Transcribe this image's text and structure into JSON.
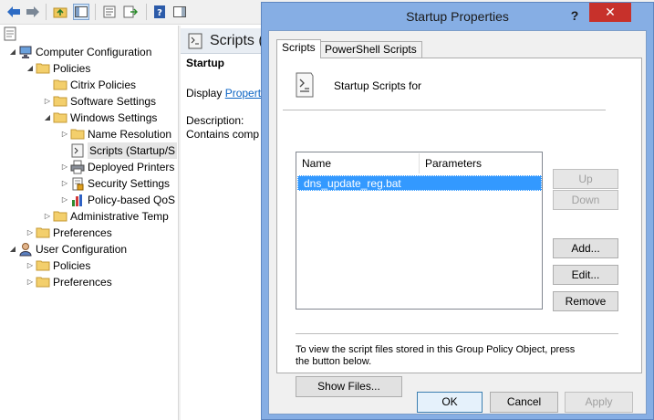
{
  "tree": {
    "root_icon": "document-icon",
    "items": [
      {
        "label": "Computer Configuration",
        "depth": 0,
        "expander": "expanded",
        "icon": "computer-icon"
      },
      {
        "label": "Policies",
        "depth": 1,
        "expander": "expanded",
        "icon": "folder-icon"
      },
      {
        "label": "Citrix Policies",
        "depth": 2,
        "expander": "none",
        "icon": "folder-icon"
      },
      {
        "label": "Software Settings",
        "depth": 2,
        "expander": "collapsed",
        "icon": "folder-icon"
      },
      {
        "label": "Windows Settings",
        "depth": 2,
        "expander": "expanded",
        "icon": "folder-icon"
      },
      {
        "label": "Name Resolution",
        "depth": 3,
        "expander": "collapsed",
        "icon": "folder-icon"
      },
      {
        "label": "Scripts (Startup/S",
        "depth": 3,
        "expander": "none",
        "icon": "script-icon",
        "selected": true
      },
      {
        "label": "Deployed Printers",
        "depth": 3,
        "expander": "collapsed",
        "icon": "printer-icon"
      },
      {
        "label": "Security Settings",
        "depth": 3,
        "expander": "collapsed",
        "icon": "security-icon"
      },
      {
        "label": "Policy-based QoS",
        "depth": 3,
        "expander": "collapsed",
        "icon": "chart-icon"
      },
      {
        "label": "Administrative Temp",
        "depth": 2,
        "expander": "collapsed",
        "icon": "folder-icon"
      },
      {
        "label": "Preferences",
        "depth": 1,
        "expander": "collapsed",
        "icon": "folder-icon"
      },
      {
        "label": "User Configuration",
        "depth": 0,
        "expander": "expanded",
        "icon": "user-icon"
      },
      {
        "label": "Policies",
        "depth": 1,
        "expander": "collapsed",
        "icon": "folder-icon"
      },
      {
        "label": "Preferences",
        "depth": 1,
        "expander": "collapsed",
        "icon": "folder-icon"
      }
    ]
  },
  "right_pane": {
    "title": "Scripts (",
    "section": "Startup",
    "display_prefix": "Display",
    "display_link": "Propert",
    "description_label": "Description:",
    "description_text": "Contains comp"
  },
  "dialog": {
    "title": "Startup Properties",
    "help_glyph": "?",
    "close_glyph": "✕",
    "tabs": [
      "Scripts",
      "PowerShell Scripts"
    ],
    "active_tab": 0,
    "header_text": "Startup Scripts for",
    "columns": [
      "Name",
      "Parameters"
    ],
    "rows": [
      {
        "name": "dns_update_reg.bat",
        "parameters": ""
      }
    ],
    "side_buttons": {
      "up": "Up",
      "down": "Down",
      "add": "Add...",
      "edit": "Edit...",
      "remove": "Remove"
    },
    "info_text_line1": "To view the script files stored in this Group Policy Object, press",
    "info_text_line2": "the button below.",
    "show_files": "Show Files...",
    "footer": {
      "ok": "OK",
      "cancel": "Cancel",
      "apply": "Apply"
    }
  },
  "colors": {
    "dialog_frame": "#86aee4",
    "close_button": "#c7312b",
    "selection": "#3399ff",
    "link": "#0a63c4"
  }
}
